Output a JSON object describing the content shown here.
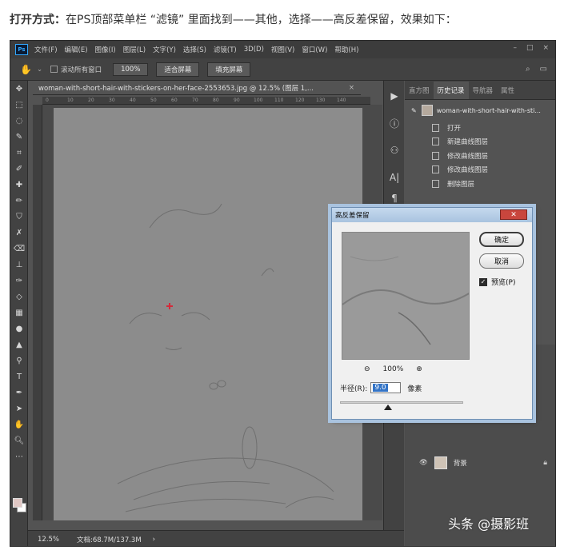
{
  "caption": {
    "lead": "打开方式：",
    "text": "在PS顶部菜单栏 “滤镜” 里面找到——其他，选择——高反差保留，效果如下："
  },
  "app": {
    "logo": "Ps",
    "menu": [
      "文件(F)",
      "编辑(E)",
      "图像(I)",
      "图层(L)",
      "文字(Y)",
      "选择(S)",
      "滤镜(T)",
      "3D(D)",
      "视图(V)",
      "窗口(W)",
      "帮助(H)"
    ],
    "window_controls": [
      "–",
      "□",
      "×"
    ]
  },
  "options": {
    "scroll_all_label": "滚动所有窗口",
    "zoom_btn": "100%",
    "fit_btn": "适合屏幕",
    "fill_btn": "填充屏幕"
  },
  "document": {
    "tab_title": "woman-with-short-hair-with-stickers-on-her-face-2553653.jpg @ 12.5% (图层 1,...",
    "close": "×",
    "ruler_ticks": [
      "0",
      "10",
      "20",
      "30",
      "40",
      "50",
      "60",
      "70",
      "80",
      "90",
      "100",
      "110",
      "120",
      "130",
      "140"
    ]
  },
  "status": {
    "zoom": "12.5%",
    "doc_info": "文档:68.7M/137.3M",
    "arrow": "›"
  },
  "panel": {
    "tabs": [
      "直方图",
      "历史记录",
      "导航器",
      "属性"
    ],
    "active_tab": "历史记录",
    "snapshot_name": "woman-with-short-hair-with-sti...",
    "history": [
      "打开",
      "新建曲线图层",
      "修改曲线图层",
      "修改曲线图层",
      "删除图层"
    ],
    "layer_name": "背景"
  },
  "dialog": {
    "title": "高反差保留",
    "ok": "确定",
    "cancel": "取消",
    "preview_label": "预览(P)",
    "preview_checked": true,
    "zoom_level": "100%",
    "radius_label": "半径(R):",
    "radius_value": "9.0",
    "radius_unit": "像素"
  },
  "watermark": "头条 @摄影班"
}
